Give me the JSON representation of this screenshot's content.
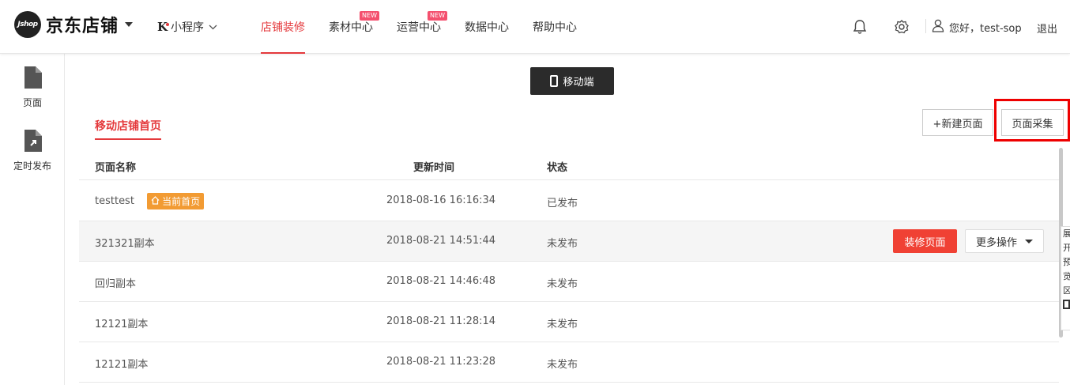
{
  "header": {
    "logo_mark": "Jshop",
    "logo_text": "京东店铺",
    "mini_program": "小程序",
    "nav": [
      {
        "label": "店铺装修",
        "active": true,
        "badge": ""
      },
      {
        "label": "素材中心",
        "active": false,
        "badge": "NEW"
      },
      {
        "label": "运营中心",
        "active": false,
        "badge": "NEW"
      },
      {
        "label": "数据中心",
        "active": false,
        "badge": ""
      },
      {
        "label": "帮助中心",
        "active": false,
        "badge": ""
      }
    ],
    "greeting": "您好，test-sop",
    "logout": "退出"
  },
  "sidebar": {
    "items": [
      {
        "label": "页面",
        "icon": "page-icon"
      },
      {
        "label": "定时发布",
        "icon": "schedule-publish-icon"
      }
    ]
  },
  "main": {
    "mobile_button": "移动端",
    "tab_label": "移动店铺首页",
    "new_page_button": "+新建页面",
    "collect_page_button": "页面采集",
    "columns": [
      "页面名称",
      "更新时间",
      "状态"
    ],
    "current_home_tag": "当前首页",
    "rows": [
      {
        "name": "testtest",
        "time": "2018-08-16 16:16:34",
        "status": "已发布",
        "is_home": true
      },
      {
        "name": "321321副本",
        "time": "2018-08-21 14:51:44",
        "status": "未发布",
        "is_home": false
      },
      {
        "name": "回归副本",
        "time": "2018-08-21 14:46:48",
        "status": "未发布",
        "is_home": false
      },
      {
        "name": "12121副本",
        "time": "2018-08-21 11:28:14",
        "status": "未发布",
        "is_home": false
      },
      {
        "name": "12121副本",
        "time": "2018-08-21 11:23:28",
        "status": "未发布",
        "is_home": false
      }
    ],
    "decorate_button": "装修页面",
    "more_actions_button": "更多操作"
  },
  "float_panel": {
    "chars": [
      "展",
      "开",
      "预",
      "览",
      "区"
    ]
  },
  "colors": {
    "accent": "#e4393c",
    "tag_orange": "#f29b33",
    "dark_button": "#2b2b2b"
  }
}
